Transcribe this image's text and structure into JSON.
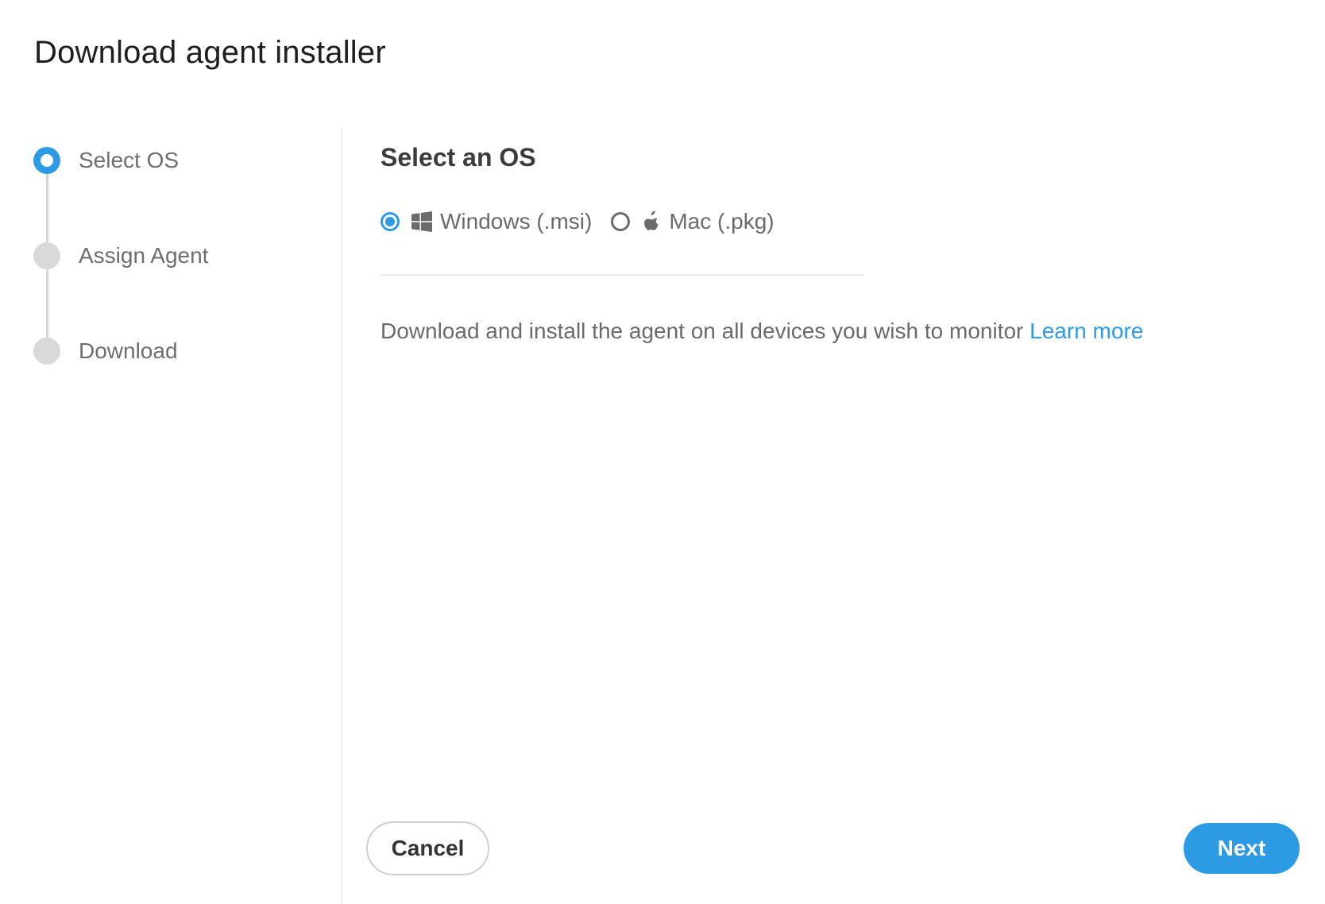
{
  "dialog": {
    "title": "Download agent installer"
  },
  "stepper": {
    "steps": [
      {
        "label": "Select OS",
        "state": "active"
      },
      {
        "label": "Assign Agent",
        "state": "inactive"
      },
      {
        "label": "Download",
        "state": "inactive"
      }
    ]
  },
  "main": {
    "heading": "Select an OS",
    "os_options": [
      {
        "label": "Windows (.msi)",
        "icon": "windows-icon",
        "checked": true
      },
      {
        "label": "Mac (.pkg)",
        "icon": "apple-icon",
        "checked": false
      }
    ],
    "description": "Download and install the agent on all devices you wish to monitor",
    "learn_more": "Learn more"
  },
  "footer": {
    "cancel_label": "Cancel",
    "next_label": "Next"
  },
  "colors": {
    "accent": "#2d9be4",
    "inactive_step": "#d9d9d9",
    "text_muted": "#6a6a6a"
  }
}
